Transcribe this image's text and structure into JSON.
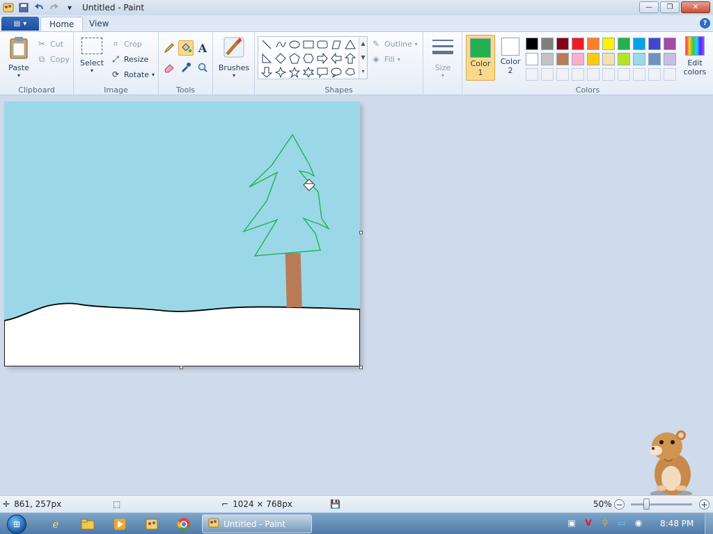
{
  "window": {
    "title": "Untitled - Paint",
    "minimize": "—",
    "maximize": "❐",
    "close": "✕"
  },
  "tabs": {
    "home": "Home",
    "view": "View",
    "help": "?"
  },
  "clipboard": {
    "paste": "Paste",
    "cut": "Cut",
    "copy": "Copy",
    "label": "Clipboard"
  },
  "image": {
    "select": "Select",
    "crop": "Crop",
    "resize": "Resize",
    "rotate": "Rotate",
    "label": "Image"
  },
  "tools": {
    "label": "Tools",
    "text_tool": "A"
  },
  "brushes": {
    "label": "Brushes"
  },
  "shapes": {
    "label": "Shapes",
    "outline": "Outline",
    "fill": "Fill"
  },
  "size": {
    "label": "Size"
  },
  "colors": {
    "label": "Colors",
    "color1_label_a": "Color",
    "color1_label_b": "1",
    "color2_label_a": "Color",
    "color2_label_b": "2",
    "edit_a": "Edit",
    "edit_b": "colors",
    "color1": "#22b14c",
    "color2": "#ffffff",
    "palette_row1": [
      "#000000",
      "#7f7f7f",
      "#880015",
      "#ed1c24",
      "#ff7f27",
      "#fff200",
      "#22b14c",
      "#00a2e8",
      "#3f48cc",
      "#a349a4"
    ],
    "palette_row2": [
      "#ffffff",
      "#c3c3c3",
      "#b97a57",
      "#ffaec9",
      "#ffc90e",
      "#efe4b0",
      "#b5e61d",
      "#99d9ea",
      "#7092be",
      "#c8bfe7"
    ]
  },
  "status": {
    "cursor_pos": "861, 257px",
    "canvas_size": "1024 × 768px",
    "zoom": "50%"
  },
  "taskbar": {
    "task_title": "Untitled - Paint",
    "clock": "8:48 PM"
  },
  "drawing": {
    "sky_color": "#9ad8e8",
    "snow_color": "#ffffff",
    "tree_outline": "#22b14c",
    "trunk_color": "#b97a57"
  }
}
